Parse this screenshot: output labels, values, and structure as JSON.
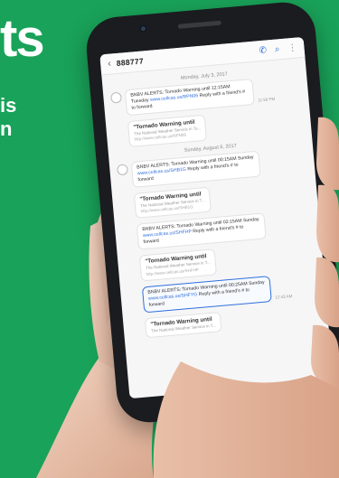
{
  "banner": {
    "headline": "ts",
    "side_line_1": "is",
    "side_line_2": "n"
  },
  "phone": {
    "header": {
      "back_icon": "chevron-left-icon",
      "number": "888777",
      "icons": [
        "phone-icon",
        "search-icon",
        "more-vertical-icon"
      ]
    },
    "thread": [
      {
        "date": "Monday, July 3, 2017",
        "messages": [
          {
            "kind": "alert",
            "text": "BNBV ALERTS: Tornado Warning until 12:15AM Tuesday",
            "link": "www.cellcas.us/RPN06",
            "tail": "Reply with a friend's # to forward",
            "time": "11:58 PM"
          },
          {
            "kind": "preview",
            "title": "\"Tornado Warning until",
            "sub": "The National Weather Service in To...",
            "url": "http://www.cellcas.us/RPN06"
          }
        ]
      },
      {
        "date": "Sunday, August 6, 2017",
        "messages": [
          {
            "kind": "alert",
            "text": "BNBV ALERTS: Tornado Warning until 00:15AM Sunday",
            "link": "www.cellcas.us/SHB1G",
            "tail": "Reply with a friend's # to forward"
          },
          {
            "kind": "preview",
            "title": "\"Tornado Warning until",
            "sub": "The National Weather Service in T...",
            "url": "http://www.cellcas.us/SHB1G"
          },
          {
            "kind": "alert",
            "text": "BNBV ALERTS: Tornado Warning until 02:15AM Sunday",
            "link": "www.cellcas.us/SHFHP",
            "tail": "Reply with a friend's # to forward"
          },
          {
            "kind": "preview",
            "title": "\"Tornado Warning until",
            "sub": "The National Weather Service in T...",
            "url": "http://www.cellcas.us/SHFHP"
          },
          {
            "kind": "alert",
            "selected": true,
            "text": "BNBV ALERTS: Tornado Warning until 00:25AM Sunday",
            "link": "www.cellcas.us/SHFYG",
            "tail": "Reply with a friend's # to forward",
            "time": "12:43 AM"
          },
          {
            "kind": "preview",
            "title": "\"Tornado Warning until",
            "sub": "The National Weather Service in T..."
          }
        ]
      }
    ]
  },
  "colors": {
    "background": "#19a259",
    "link": "#2f6fdc",
    "phone_body": "#1b1c1f",
    "skin": "#ecc8b3"
  }
}
